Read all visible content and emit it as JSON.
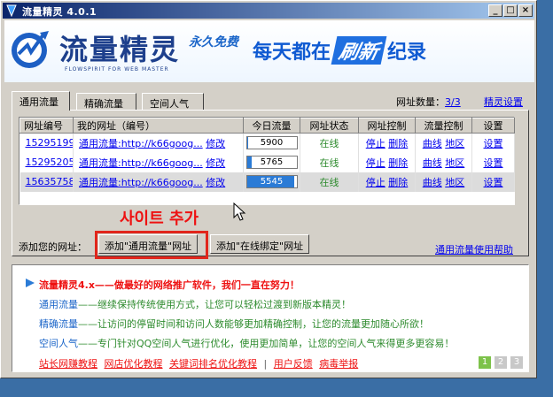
{
  "window": {
    "title": "流量精灵 4.0.1",
    "minimize_glyph": "_",
    "maximize_glyph": "□",
    "close_glyph": "×"
  },
  "banner": {
    "logo_text": "流量精灵",
    "logo_sub": "FLOWSPIRIT FOR WEB MASTER",
    "free_tag": "永久免费",
    "slogan_a": "每天都在",
    "slogan_hl": "刷新",
    "slogan_b": "纪录"
  },
  "tabs": [
    {
      "label": "通用流量"
    },
    {
      "label": "精确流量"
    },
    {
      "label": "空间人气"
    }
  ],
  "count": {
    "label": "网址数量：",
    "value": "3/3"
  },
  "settings_link": "精灵设置",
  "table": {
    "headers": [
      "网址编号",
      "我的网址（编号）",
      "今日流量",
      "网址状态",
      "网址控制",
      "流量控制",
      "设置"
    ],
    "rows": [
      {
        "id": "15295199",
        "url": "通用流量:http://k66goog...",
        "edit": "修改",
        "traffic": "5900",
        "fill": 0.02,
        "status": "在线",
        "stop": "停止",
        "delete": "删除",
        "curve": "曲线",
        "region": "地区",
        "setting": "设置"
      },
      {
        "id": "15295205",
        "url": "通用流量:http://k66goog...",
        "edit": "修改",
        "traffic": "5765",
        "fill": 0.1,
        "status": "在线",
        "stop": "停止",
        "delete": "删除",
        "curve": "曲线",
        "region": "地区",
        "setting": "设置"
      },
      {
        "id": "15635758",
        "url": "通用流量:http://k66goog...",
        "edit": "修改",
        "traffic": "5545",
        "fill": 0.95,
        "status": "在线",
        "stop": "停止",
        "delete": "删除",
        "curve": "曲线",
        "region": "地区",
        "setting": "设置"
      }
    ]
  },
  "overlay_note": "사이트 추가",
  "add": {
    "label": "添加您的网址：",
    "btn_general": "添加\"通用流量\"网址",
    "btn_online": "添加\"在线绑定\"网址"
  },
  "help_link": "通用流量使用帮助",
  "news": {
    "head": "流量精灵4.x——做最好的网络推广软件，我们一直在努力！",
    "lines": [
      {
        "hl": "通用流量",
        "text": "——继续保持传统使用方式，让您可以轻松过渡到新版本精灵！"
      },
      {
        "hl": "精确流量",
        "text": "——让访问的停留时间和访问人数能够更加精确控制，让您的流量更加随心所欲！"
      },
      {
        "hl": "空间人气",
        "text": "——专门针对QQ空间人气进行优化，使用更加简单，让您的空间人气来得更多更容易！"
      }
    ],
    "links": [
      "站长网赚教程",
      "网店优化教程",
      "关键词排名优化教程"
    ],
    "links2": [
      "用户反馈",
      "病毒举报"
    ],
    "sep": "|",
    "pages": [
      "1",
      "2",
      "3"
    ]
  }
}
